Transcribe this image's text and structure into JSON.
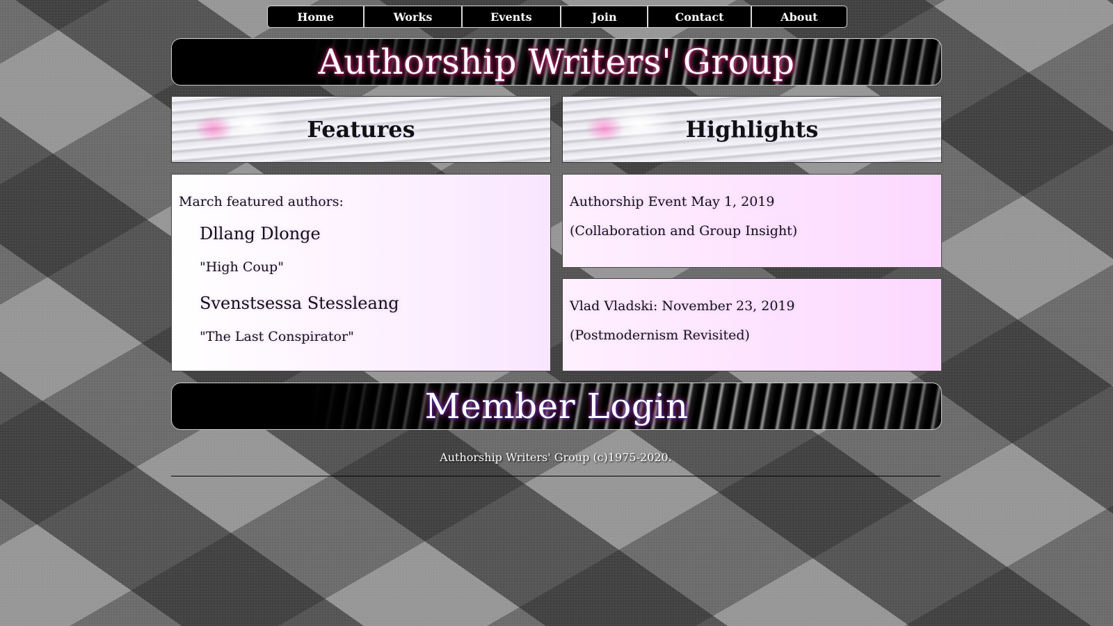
{
  "nav": {
    "items": [
      {
        "label": "Home"
      },
      {
        "label": "Works"
      },
      {
        "label": "Events"
      },
      {
        "label": "Join"
      },
      {
        "label": "Contact"
      },
      {
        "label": "About"
      }
    ]
  },
  "header": {
    "title": "Authorship Writers' Group"
  },
  "features": {
    "heading": "Features",
    "intro": "March featured authors:",
    "authors": [
      {
        "name": "Dllang Dlonge",
        "work": "\"High Coup\""
      },
      {
        "name": "Svenstsessa Stessleang",
        "work": "\"The Last Conspirator\""
      }
    ]
  },
  "highlights": {
    "heading": "Highlights",
    "events": [
      {
        "line1": "Authorship Event May 1, 2019",
        "line2": "(Collaboration and Group Insight)"
      },
      {
        "line1": "Vlad Vladski: November 23, 2019",
        "line2": "(Postmodernism Revisited)"
      }
    ]
  },
  "member_login": {
    "label": "Member Login"
  },
  "footer": {
    "copyright": "Authorship Writers' Group (c)1975-2020."
  }
}
